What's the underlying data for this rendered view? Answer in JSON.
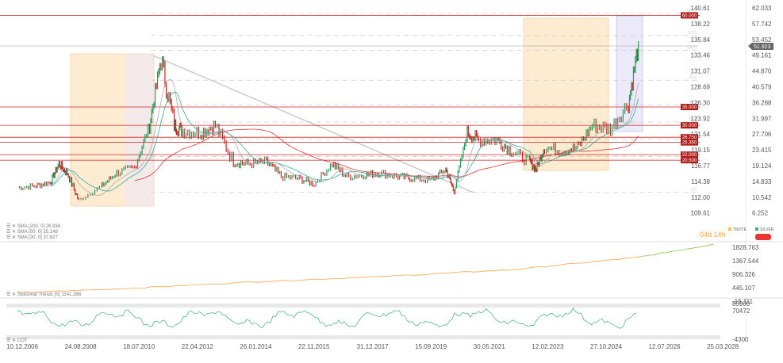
{
  "chart_data": {
    "type": "line",
    "symbol": "SILVER",
    "last_price": "51.923",
    "x_dates": [
      "10.12.2006",
      "24.08.2008",
      "18.07.2010",
      "22.04.2012",
      "26.01.2014",
      "22.11.2015",
      "31.12.2017",
      "15.09.2019",
      "30.05.2021",
      "12.02.2023",
      "27.10.2024",
      "12.07.2026",
      "25.03.2028"
    ],
    "y_right": [
      "62.033",
      "57.742",
      "53.452",
      "49.161",
      "44.870",
      "40.579",
      "36.288",
      "31.997",
      "27.706",
      "23.415",
      "19.124",
      "14.833",
      "10.542",
      "6.252"
    ],
    "y_left": [
      "140.61",
      "138.22",
      "135.84",
      "133.46",
      "131.07",
      "128.69",
      "126.30",
      "123.92",
      "121.54",
      "119.15",
      "116.77",
      "114.38",
      "112.00",
      "109.61"
    ],
    "ylim": [
      6.252,
      62.033
    ],
    "series": {
      "x": [
        2006.94,
        2007.5,
        2007.95,
        2008.2,
        2008.45,
        2008.8,
        2009.5,
        2009.95,
        2010.5,
        2010.95,
        2011.3,
        2011.7,
        2011.95,
        2012.5,
        2012.95,
        2013.5,
        2013.95,
        2014.5,
        2014.95,
        2015.5,
        2015.95,
        2016.5,
        2016.95,
        2017.5,
        2017.95,
        2018.5,
        2018.95,
        2019.5,
        2019.95,
        2020.2,
        2020.6,
        2020.95,
        2021.5,
        2021.95,
        2022.5,
        2022.7,
        2022.95,
        2023.5,
        2023.95,
        2024.4,
        2024.95,
        2025.5,
        2025.8
      ],
      "y": [
        13,
        13.5,
        14.5,
        19.5,
        17,
        9.5,
        13.5,
        17,
        18.5,
        30,
        48,
        30,
        28.5,
        28,
        30,
        20,
        19.5,
        20,
        16,
        15.5,
        14,
        19.5,
        16,
        16.5,
        17,
        16,
        15.5,
        15,
        18,
        12,
        28,
        26,
        26,
        23,
        20,
        18,
        24,
        23,
        24,
        30,
        29,
        36,
        51.9
      ]
    },
    "sma": [
      {
        "label": "SMA [200, 0]",
        "value": "26.934",
        "color": "#d33"
      },
      {
        "label": "SMA [50, 0]",
        "value": "25.148",
        "color": "#3a9"
      },
      {
        "label": "SMA [30, 0]",
        "value": "37.827",
        "color": "#aaa"
      }
    ],
    "levels": [
      {
        "value": 60,
        "label": "60.000"
      },
      {
        "value": 35,
        "label": "35.000"
      },
      {
        "value": 30,
        "label": "30.000"
      },
      {
        "value": 26.75,
        "label": "26.750"
      },
      {
        "value": 25.35,
        "label": "25.350"
      },
      {
        "value": 22,
        "label": "22.000"
      },
      {
        "value": 20.5,
        "label": "20.500"
      }
    ],
    "fib": [
      {
        "value": 60.5,
        "label": "127.2"
      },
      {
        "value": 54.5,
        "label": "113.0"
      },
      {
        "value": 50.5,
        "label": "100.0"
      },
      {
        "value": 42.3,
        "label": "78.6"
      },
      {
        "value": 35.6,
        "label": "61.8"
      },
      {
        "value": 30.9,
        "label": "50.0"
      },
      {
        "value": 26.2,
        "label": "38.2"
      },
      {
        "value": 21.5,
        "label": "23.6"
      },
      {
        "value": 11.8,
        "label": "0.0"
      }
    ],
    "seasonal": {
      "label": "Seasonal Trends [S]",
      "value": "1141.388",
      "y_axis": [
        "1828.763",
        "1367.544",
        "906.326",
        "445.107",
        "-16.111"
      ],
      "x": [
        2006.94,
        2010,
        2014,
        2018,
        2022,
        2025.8,
        2028.2
      ],
      "y": [
        60,
        200,
        450,
        650,
        900,
        1350,
        1850
      ]
    },
    "cot": {
      "label": "COT",
      "y_axis": [
        "85900",
        "70472",
        "-4300"
      ]
    },
    "legend": [
      {
        "name": "TNOTE",
        "color": "#f5c542"
      },
      {
        "name": "SILVER",
        "color": "#3bb36b"
      }
    ],
    "countdown": {
      "days": "04d",
      "hours": "14h"
    }
  }
}
